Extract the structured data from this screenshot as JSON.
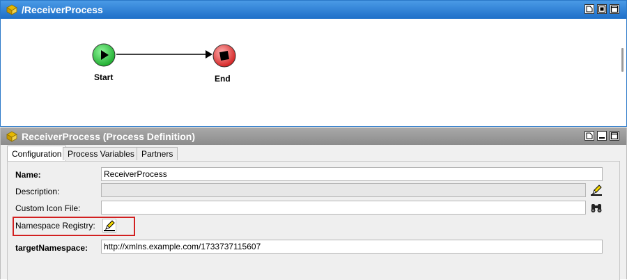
{
  "top_panel": {
    "title": "/ReceiverProcess",
    "nodes": {
      "start_label": "Start",
      "end_label": "End"
    }
  },
  "bottom_panel": {
    "title": "ReceiverProcess (Process Definition)",
    "tabs": [
      {
        "label": "Configuration",
        "active": true
      },
      {
        "label": "Process Variables",
        "active": false
      },
      {
        "label": "Partners",
        "active": false
      }
    ],
    "form": {
      "name_label": "Name:",
      "name_value": "ReceiverProcess",
      "description_label": "Description:",
      "description_value": "",
      "custom_icon_label": "Custom Icon File:",
      "custom_icon_value": "",
      "namespace_registry_label": "Namespace Registry:",
      "target_namespace_label": "targetNamespace:",
      "target_namespace_value": "http://xmlns.example.com/1733737115607"
    }
  },
  "colors": {
    "title_blue": "#1e6fc8",
    "title_gray": "#8c8c8c",
    "start_green": "#2ecc40",
    "end_red": "#e83a3a",
    "highlight_red": "#d22020"
  }
}
